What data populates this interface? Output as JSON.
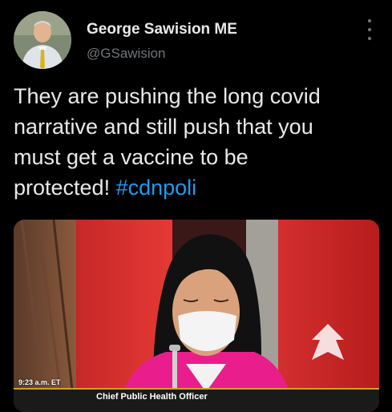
{
  "author": {
    "display_name": "George Sawision ME",
    "handle": "@GSawision"
  },
  "tweet": {
    "lines": [
      "They are pushing the long covid",
      "narrative and still push that you",
      "must get a vaccine to be"
    ],
    "last_line_text": "protected! ",
    "hashtag": "#cdnpoli"
  },
  "media": {
    "timestamp": "9:23 a.m. ET",
    "ticker_text": "Chief Public Health Officer"
  },
  "colors": {
    "background": "#000000",
    "text": "#e7e9ea",
    "secondary": "#71767b",
    "link": "#1d9bf0"
  },
  "icons": {
    "more": "more-horizontal-icon"
  }
}
